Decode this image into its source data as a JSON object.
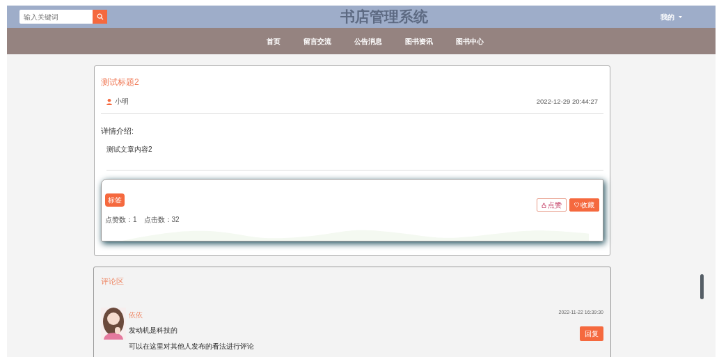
{
  "header": {
    "search": {
      "placeholder": "输入关键词"
    },
    "title": "书店管理系统",
    "user_menu": "我的"
  },
  "nav": {
    "items": [
      {
        "label": "首页",
        "selected": false
      },
      {
        "label": "留言交流",
        "selected": false
      },
      {
        "label": "公告消息",
        "selected": false
      },
      {
        "label": "图书资讯",
        "selected": false
      },
      {
        "label": "图书中心",
        "selected": false
      }
    ]
  },
  "article": {
    "title": "测试标题2",
    "author": "小明",
    "time": "2022-12-29 20:44:27",
    "intro_label": "详情介绍:",
    "content": "测试文章内容2",
    "tag": "标签",
    "stats": "点赞数：1　点击数：32",
    "buttons": [
      {
        "kind": "outline",
        "label": "点赞"
      },
      {
        "kind": "solid",
        "label": "收藏"
      }
    ]
  },
  "comments": {
    "title": "评论区",
    "items": [
      {
        "name": "依依",
        "time": "2022-11-22 16:39:30",
        "text": "发动机是科技的",
        "hint": "可以在这里对其他人发布的看法进行评论",
        "reply": "回复"
      }
    ]
  }
}
